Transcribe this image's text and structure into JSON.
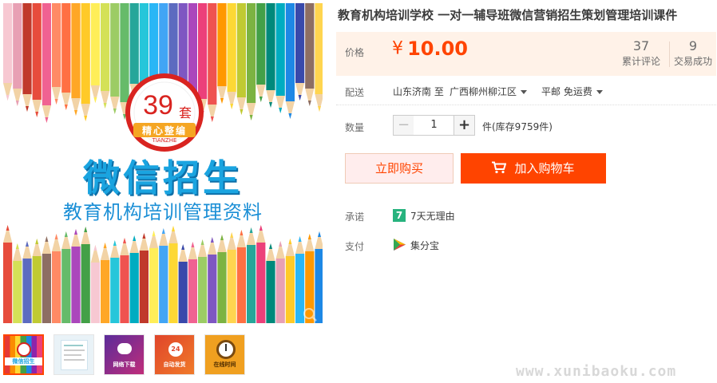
{
  "product": {
    "title": "教育机构培训学校 一对一辅导班微信营销招生策划管理培训课件",
    "main_image": {
      "badge_number": "39",
      "badge_unit": "套",
      "badge_ribbon": "精心整编",
      "badge_sub": "TIANZHE",
      "headline": "微信招生",
      "subheadline": "教育机构培训管理资料",
      "icon": "zoom-icon"
    },
    "thumbnails": [
      {
        "label": "微信招生",
        "bg": "#e8a030",
        "active": true
      },
      {
        "label": "",
        "bg": "#e9f2f7",
        "active": false
      },
      {
        "label": "网络下载",
        "bg": "#7b3ca8",
        "active": false
      },
      {
        "label": "自动发货",
        "bg": "#e0452a",
        "active": false
      },
      {
        "label": "在线时间",
        "bg": "#f0a020",
        "active": false
      }
    ]
  },
  "price": {
    "label": "价格",
    "currency": "¥",
    "amount": "10.00",
    "color": "#ff4400"
  },
  "stats": {
    "reviews_count": "37",
    "reviews_label": "累计评论",
    "sales_count": "9",
    "sales_label": "交易成功"
  },
  "shipping": {
    "label": "配送",
    "from": "山东济南 至",
    "to": "广西柳州柳江区",
    "method": "平邮 免运费"
  },
  "quantity": {
    "label": "数量",
    "value": "1",
    "minus": "−",
    "plus": "+",
    "stock": "件(库存9759件)"
  },
  "actions": {
    "buy_now": "立即购买",
    "add_to_cart": "加入购物车"
  },
  "promise": {
    "label": "承诺",
    "icon_text": "7",
    "text": "7天无理由"
  },
  "payment": {
    "label": "支付",
    "icon": "jifenbao-icon",
    "text": "集分宝"
  },
  "watermark": "www.xunibaoku.com"
}
